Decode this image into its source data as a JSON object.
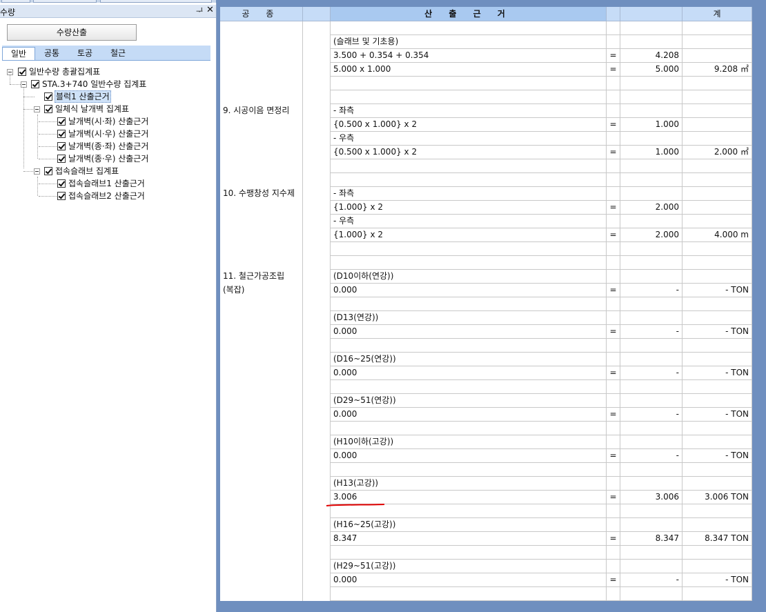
{
  "panel": {
    "title": "수량",
    "pin": "ᆛ",
    "close": "✕"
  },
  "calc_button": "수량산출",
  "tabs": [
    "일반",
    "공통",
    "토공",
    "철근"
  ],
  "tree": {
    "root": "일반수량 총괄집계표",
    "sta": "STA.3+740 일반수량 집계표",
    "block1": "블럭1 산출근거",
    "wing_group": "일체식 날개벽 집계표",
    "wing1": "날개벽(시·좌) 산출근거",
    "wing2": "날개벽(시·우) 산출근거",
    "wing3": "날개벽(종·좌) 산출근거",
    "wing4": "날개벽(종·우) 산출근거",
    "slab_group": "접속슬래브 집계표",
    "slab1": "접속슬래브1 산출근거",
    "slab2": "접속슬래브2 산출근거"
  },
  "grid": {
    "headers": [
      "공 종",
      "",
      "산 출 근 거",
      "",
      "",
      "계"
    ],
    "rows": [
      [
        "",
        "",
        "",
        "",
        "",
        ""
      ],
      [
        "",
        "",
        "(슬래브 및 기초용)",
        "",
        "",
        ""
      ],
      [
        "",
        "",
        "3.500 + 0.354 + 0.354",
        "=",
        "4.208",
        ""
      ],
      [
        "",
        "",
        "5.000 x 1.000",
        "=",
        "5.000",
        "9.208 ㎡"
      ],
      [
        "",
        "",
        "",
        "",
        "",
        ""
      ],
      [
        "",
        "",
        "",
        "",
        "",
        ""
      ],
      [
        "9. 시공이음 면정리",
        "",
        "- 좌측",
        "",
        "",
        ""
      ],
      [
        "",
        "",
        "{0.500 x 1.000} x 2",
        "=",
        "1.000",
        ""
      ],
      [
        "",
        "",
        "- 우측",
        "",
        "",
        ""
      ],
      [
        "",
        "",
        "{0.500 x 1.000} x 2",
        "=",
        "1.000",
        "2.000 ㎡"
      ],
      [
        "",
        "",
        "",
        "",
        "",
        ""
      ],
      [
        "",
        "",
        "",
        "",
        "",
        ""
      ],
      [
        "10. 수팽창성 지수제",
        "",
        "- 좌측",
        "",
        "",
        ""
      ],
      [
        "",
        "",
        "{1.000} x 2",
        "=",
        "2.000",
        ""
      ],
      [
        "",
        "",
        "- 우측",
        "",
        "",
        ""
      ],
      [
        "",
        "",
        "{1.000} x 2",
        "=",
        "2.000",
        "4.000 m"
      ],
      [
        "",
        "",
        "",
        "",
        "",
        ""
      ],
      [
        "",
        "",
        "",
        "",
        "",
        ""
      ],
      [
        "11. 철근가공조립",
        "",
        "(D10이하(연강))",
        "",
        "",
        ""
      ],
      [
        "(복잡)",
        "",
        "0.000",
        "=",
        "-",
        "- TON"
      ],
      [
        "",
        "",
        "",
        "",
        "",
        ""
      ],
      [
        "",
        "",
        "(D13(연강))",
        "",
        "",
        ""
      ],
      [
        "",
        "",
        "0.000",
        "=",
        "-",
        "- TON"
      ],
      [
        "",
        "",
        "",
        "",
        "",
        ""
      ],
      [
        "",
        "",
        "(D16~25(연강))",
        "",
        "",
        ""
      ],
      [
        "",
        "",
        "0.000",
        "=",
        "-",
        "- TON"
      ],
      [
        "",
        "",
        "",
        "",
        "",
        ""
      ],
      [
        "",
        "",
        "(D29~51(연강))",
        "",
        "",
        ""
      ],
      [
        "",
        "",
        "0.000",
        "=",
        "-",
        "- TON"
      ],
      [
        "",
        "",
        "",
        "",
        "",
        ""
      ],
      [
        "",
        "",
        "(H10이하(고강))",
        "",
        "",
        ""
      ],
      [
        "",
        "",
        "0.000",
        "=",
        "-",
        "- TON"
      ],
      [
        "",
        "",
        "",
        "",
        "",
        ""
      ],
      [
        "",
        "",
        "(H13(고강))",
        "",
        "",
        ""
      ],
      [
        "",
        "",
        "3.006",
        "=",
        "3.006",
        "3.006 TON"
      ],
      [
        "",
        "",
        "",
        "",
        "",
        ""
      ],
      [
        "",
        "",
        "(H16~25(고강))",
        "",
        "",
        ""
      ],
      [
        "",
        "",
        "8.347",
        "=",
        "8.347",
        "8.347 TON"
      ],
      [
        "",
        "",
        "",
        "",
        "",
        ""
      ],
      [
        "",
        "",
        "(H29~51(고강))",
        "",
        "",
        ""
      ],
      [
        "",
        "",
        "0.000",
        "=",
        "-",
        "- TON"
      ],
      [
        "",
        "",
        "",
        "",
        "",
        ""
      ]
    ]
  },
  "annotation": {
    "underline_color": "#e00000"
  }
}
